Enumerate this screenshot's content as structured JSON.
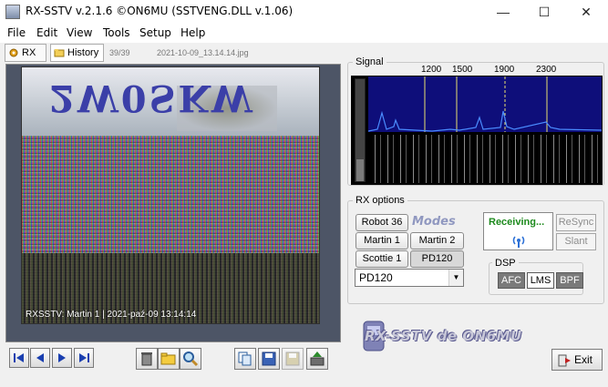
{
  "window": {
    "title": "RX-SSTV v.2.1.6 ©ON6MU (SSTVENG.DLL v.1.06)"
  },
  "window_controls": {
    "minimize": "—",
    "maximize": "☐",
    "close": "✕"
  },
  "menu": [
    "File",
    "Edit",
    "View",
    "Tools",
    "Setup",
    "Help"
  ],
  "tabs": [
    {
      "label": "RX"
    },
    {
      "label": "History"
    }
  ],
  "history": {
    "counter": "39/39",
    "filename": "2021-10-09_13.14.14.jpg"
  },
  "image": {
    "caption": "RXSSTV: Martin 1 | 2021-paź-09 13:14:14"
  },
  "signal": {
    "title": "Signal",
    "freq_labels": [
      "1200",
      "1500",
      "1900",
      "2300"
    ]
  },
  "rx_options": {
    "title": "RX options",
    "modes_logo": "Modes",
    "modes": [
      "Robot 36",
      "Martin 1",
      "Martin 2",
      "Scottie 1",
      "PD120"
    ],
    "selected_mode": "PD120",
    "status": "Receiving...",
    "resync_label": "ReSync",
    "slant_label": "Slant"
  },
  "dsp": {
    "title": "DSP",
    "buttons": [
      "AFC",
      "LMS",
      "BPF"
    ]
  },
  "logo": {
    "text": "RX-SSTV de ON6MU"
  },
  "exit_label": "Exit",
  "colors": {
    "spectrum_bg": "#0e0e7a",
    "receiving_green": "#1d8a1d",
    "marker_yellow": "#e8e070"
  }
}
